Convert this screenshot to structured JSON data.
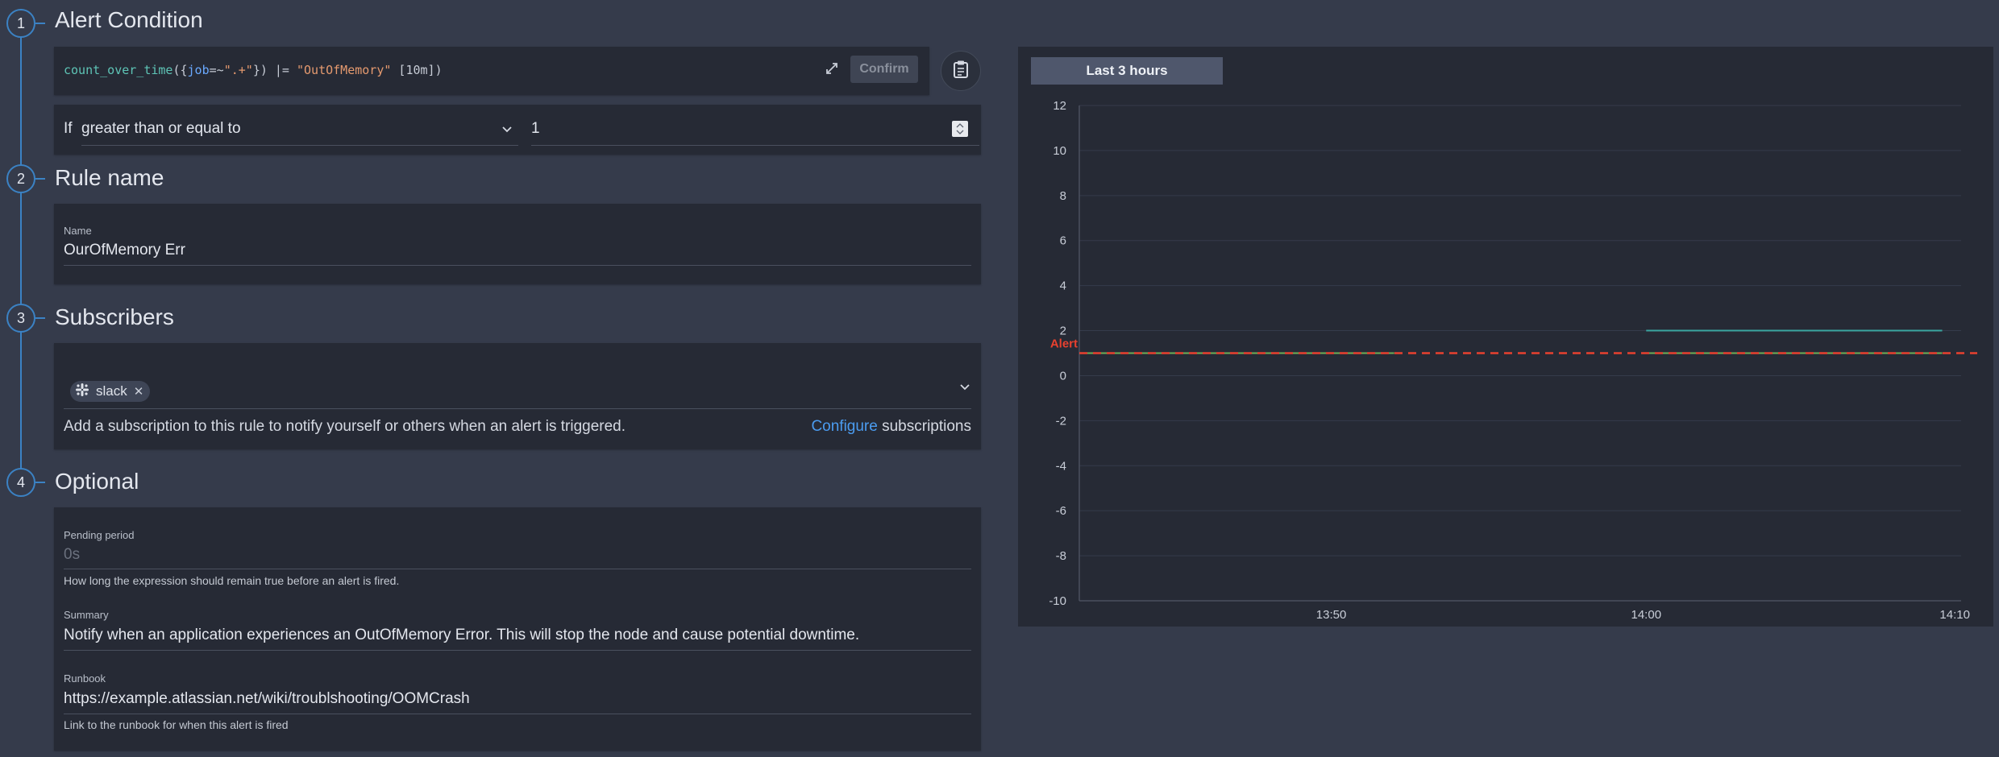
{
  "steps": [
    {
      "number": "1",
      "title": "Alert Condition"
    },
    {
      "number": "2",
      "title": "Rule name"
    },
    {
      "number": "3",
      "title": "Subscribers"
    },
    {
      "number": "4",
      "title": "Optional"
    }
  ],
  "query": {
    "fn": "count_over_time",
    "open": "({",
    "label": "job",
    "match_op": "=~",
    "label_value": "\".+\"",
    "close": "})",
    "filter_op": " |= ",
    "filter_str": "\"OutOfMemory\"",
    "range": " [10m])",
    "confirm_label": "Confirm",
    "expand_icon": "expand-icon",
    "clipboard_icon": "clipboard-icon"
  },
  "condition": {
    "if_label": "If",
    "operator": "greater than or equal to",
    "threshold": "1"
  },
  "rule": {
    "name_label": "Name",
    "name_value": "OurOfMemory Err"
  },
  "subscribers": {
    "chip_label": "slack",
    "chip_icon": "slack-icon",
    "description": "Add a subscription to this rule to notify yourself or others when an alert is triggered.",
    "configure_link": "Configure",
    "configure_suffix": " subscriptions"
  },
  "optional": {
    "pending_label": "Pending period",
    "pending_placeholder": "0s",
    "pending_help": "How long the expression should remain true before an alert is fired.",
    "summary_label": "Summary",
    "summary_value": "Notify when an application experiences an OutOfMemory Error. This will stop the node and cause potential downtime.",
    "runbook_label": "Runbook",
    "runbook_value": "https://example.atlassian.net/wiki/troublshooting/OOMCrash",
    "runbook_help": "Link to the runbook for when this alert is fired"
  },
  "chart": {
    "range_label": "Last 3 hours"
  },
  "chart_data": {
    "type": "line",
    "ylim": [
      -10,
      12
    ],
    "yticks": [
      12,
      10,
      8,
      6,
      4,
      2,
      0,
      -2,
      -4,
      -6,
      -8,
      -10
    ],
    "xlim": [
      "13:42",
      "14:10"
    ],
    "xticks": [
      {
        "label": "13:50",
        "t": 8
      },
      {
        "label": "14:00",
        "t": 18
      },
      {
        "label": "14:10",
        "t": 27.8
      }
    ],
    "threshold": {
      "label": "Alert",
      "value": 1
    },
    "series": [
      {
        "values": [
          [
            0,
            1
          ],
          [
            10,
            1
          ]
        ],
        "color": "#6fae56"
      },
      {
        "values": [
          [
            18,
            1
          ],
          [
            27.4,
            1
          ]
        ],
        "color": "#6fae56"
      },
      {
        "values": [
          [
            18,
            2
          ],
          [
            27.4,
            2
          ]
        ],
        "color": "#3aa6a1"
      }
    ],
    "grid": true,
    "colors": {
      "threshold": "#e8412f",
      "grid": "#353b4b"
    }
  }
}
